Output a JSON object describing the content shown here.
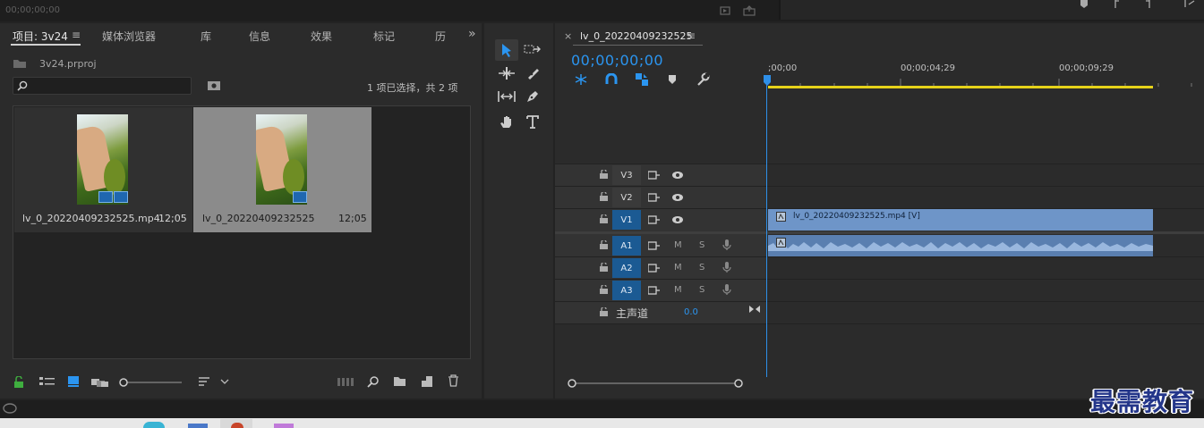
{
  "top": {
    "timecode": "00;00;00;00"
  },
  "project": {
    "tabs": [
      "项目: 3v24",
      "媒体浏览器",
      "库",
      "信息",
      "效果",
      "标记",
      "历"
    ],
    "tab_menu_glyph": "≡",
    "overflow_glyph": "»",
    "file_name": "3v24.prproj",
    "search_placeholder": "",
    "selection_status": "1 项已选择，共 2 项",
    "clips": [
      {
        "name": "lv_0_20220409232525.mp4",
        "duration": "12;05",
        "selected": false
      },
      {
        "name": "lv_0_20220409232525",
        "duration": "12;05",
        "selected": true
      }
    ]
  },
  "sequence": {
    "close_glyph": "×",
    "name": "lv_0_20220409232525",
    "menu_glyph": "≡",
    "timecode": "00;00;00;00",
    "ruler_labels": [
      ";00;00",
      "00;00;04;29",
      "00;00;09;29"
    ],
    "video_tracks": [
      "V3",
      "V2",
      "V1"
    ],
    "audio_tracks": [
      "A1",
      "A2",
      "A3"
    ],
    "mute_label": "M",
    "solo_label": "S",
    "video_clip_name": "lv_0_20220409232525.mp4 [V]",
    "master_label": "主声道",
    "master_value": "0.0"
  },
  "colors": {
    "accent": "#2b95f0",
    "track_target": "#1b5a93",
    "video_clip": "#6e95c8",
    "audio_clip": "#5a7fb0",
    "in_out": "#e6d21a"
  },
  "watermark": "最需教育"
}
